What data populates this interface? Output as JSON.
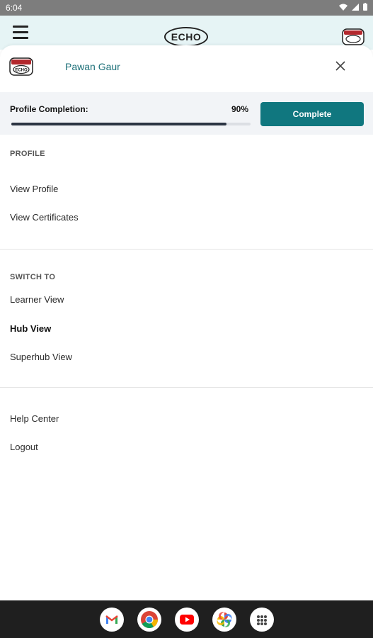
{
  "status_bar": {
    "time": "6:04"
  },
  "app_bar": {
    "logo_text": "ECHO"
  },
  "drawer": {
    "user_name": "Pawan Gaur",
    "profile_completion": {
      "label": "Profile Completion:",
      "value_text": "90%",
      "fraction": 0.9
    },
    "complete_button": "Complete",
    "profile_section": {
      "title": "PROFILE",
      "items": [
        "View Profile",
        "View Certificates"
      ]
    },
    "switch_section": {
      "title": "SWITCH TO",
      "items": [
        "Learner View",
        "Hub View",
        "Superhub View"
      ]
    },
    "other_items": [
      "Help Center",
      "Logout"
    ]
  },
  "colors": {
    "accent": "#10777f",
    "header_bg": "#e6f4f5",
    "name_color": "#1b6f78"
  },
  "dock_apps": [
    "gmail-icon",
    "chrome-icon",
    "youtube-icon",
    "photos-icon",
    "app-drawer-icon"
  ]
}
